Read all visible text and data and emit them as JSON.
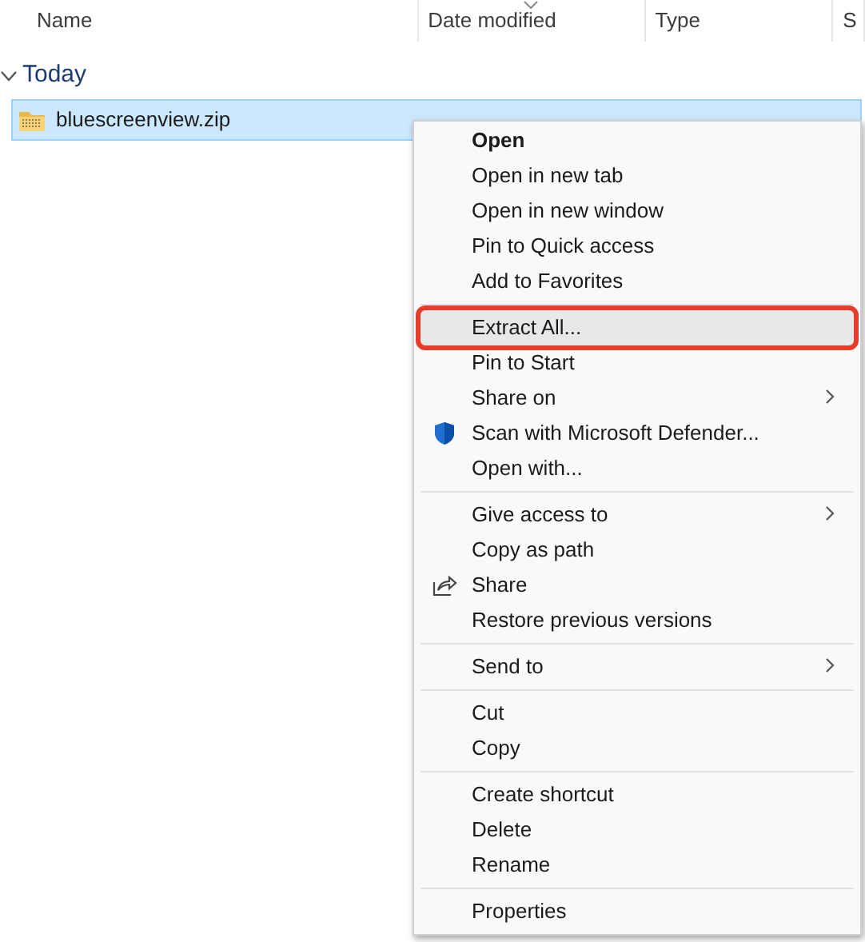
{
  "columns": [
    {
      "label": "Name",
      "sorted": false
    },
    {
      "label": "Date modified",
      "sorted": true
    },
    {
      "label": "Type",
      "sorted": false
    },
    {
      "label": "S",
      "sorted": false
    }
  ],
  "group": {
    "label": "Today",
    "expanded": true
  },
  "files": [
    {
      "name": "bluescreenview.zip",
      "selected": true
    }
  ],
  "context_menu": {
    "sections": [
      [
        {
          "label": "Open",
          "kind": "plain",
          "default": true,
          "highlighted": false,
          "submenu": false
        },
        {
          "label": "Open in new tab",
          "kind": "plain",
          "default": false,
          "highlighted": false,
          "submenu": false
        },
        {
          "label": "Open in new window",
          "kind": "plain",
          "default": false,
          "highlighted": false,
          "submenu": false
        },
        {
          "label": "Pin to Quick access",
          "kind": "plain",
          "default": false,
          "highlighted": false,
          "submenu": false
        },
        {
          "label": "Add to Favorites",
          "kind": "plain",
          "default": false,
          "highlighted": false,
          "submenu": false
        }
      ],
      [
        {
          "label": "Extract All...",
          "kind": "plain",
          "default": false,
          "highlighted": true,
          "submenu": false
        },
        {
          "label": "Pin to Start",
          "kind": "plain",
          "default": false,
          "highlighted": false,
          "submenu": false
        },
        {
          "label": "Share on",
          "kind": "plain",
          "default": false,
          "highlighted": false,
          "submenu": true
        },
        {
          "label": "Scan with Microsoft Defender...",
          "kind": "scan",
          "default": false,
          "highlighted": false,
          "submenu": false
        },
        {
          "label": "Open with...",
          "kind": "plain",
          "default": false,
          "highlighted": false,
          "submenu": false
        }
      ],
      [
        {
          "label": "Give access to",
          "kind": "plain",
          "default": false,
          "highlighted": false,
          "submenu": true
        },
        {
          "label": "Copy as path",
          "kind": "plain",
          "default": false,
          "highlighted": false,
          "submenu": false
        },
        {
          "label": "Share",
          "kind": "share",
          "default": false,
          "highlighted": false,
          "submenu": false
        },
        {
          "label": "Restore previous versions",
          "kind": "plain",
          "default": false,
          "highlighted": false,
          "submenu": false
        }
      ],
      [
        {
          "label": "Send to",
          "kind": "plain",
          "default": false,
          "highlighted": false,
          "submenu": true
        }
      ],
      [
        {
          "label": "Cut",
          "kind": "plain",
          "default": false,
          "highlighted": false,
          "submenu": false
        },
        {
          "label": "Copy",
          "kind": "plain",
          "default": false,
          "highlighted": false,
          "submenu": false
        }
      ],
      [
        {
          "label": "Create shortcut",
          "kind": "plain",
          "default": false,
          "highlighted": false,
          "submenu": false
        },
        {
          "label": "Delete",
          "kind": "plain",
          "default": false,
          "highlighted": false,
          "submenu": false
        },
        {
          "label": "Rename",
          "kind": "plain",
          "default": false,
          "highlighted": false,
          "submenu": false
        }
      ],
      [
        {
          "label": "Properties",
          "kind": "plain",
          "default": false,
          "highlighted": false,
          "submenu": false
        }
      ]
    ]
  }
}
